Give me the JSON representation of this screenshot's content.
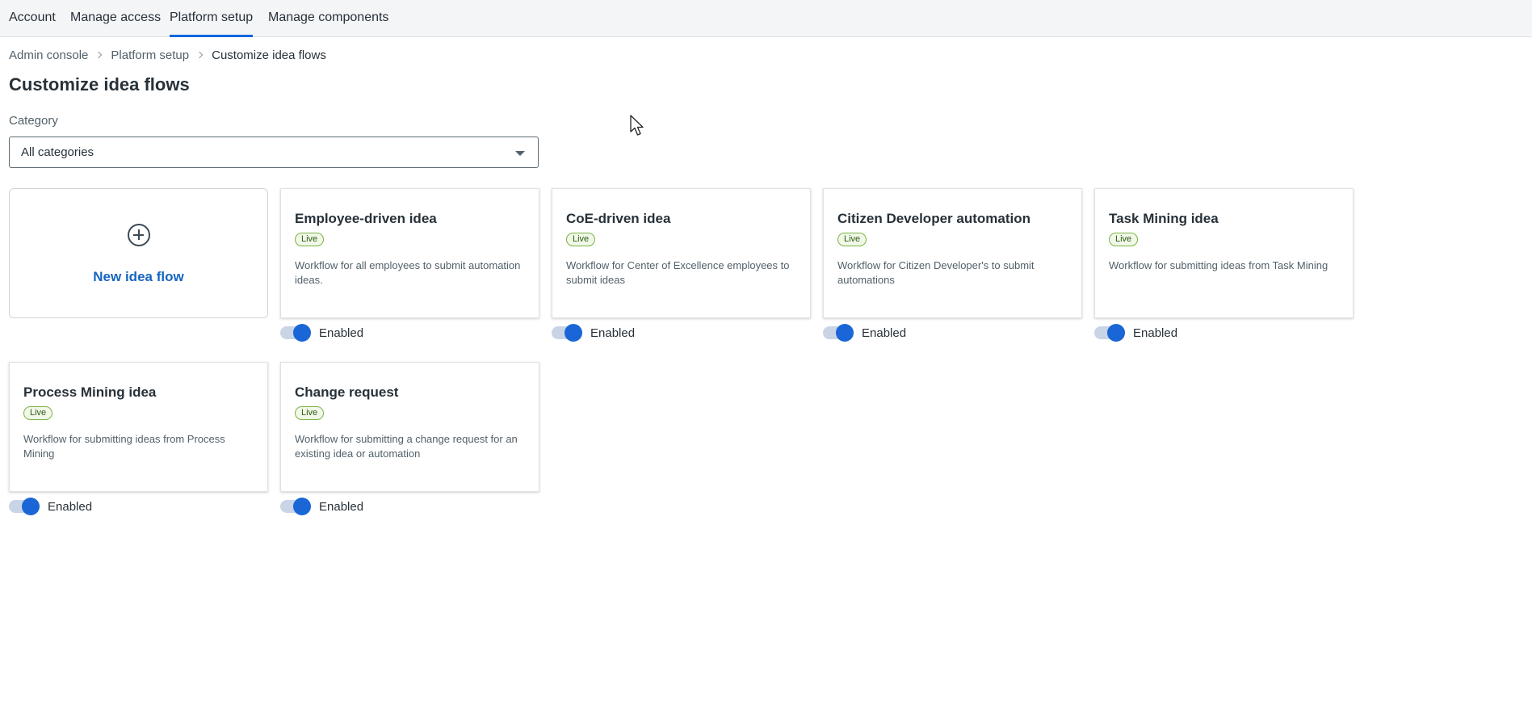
{
  "nav": {
    "tabs": [
      {
        "label": "Account",
        "active": false
      },
      {
        "label": "Manage access",
        "active": false
      },
      {
        "label": "Platform setup",
        "active": true
      },
      {
        "label": "Manage components",
        "active": false
      }
    ]
  },
  "breadcrumb": [
    "Admin console",
    "Platform setup",
    "Customize idea flows"
  ],
  "page": {
    "title": "Customize idea flows"
  },
  "filter": {
    "label": "Category",
    "value": "All categories"
  },
  "new_flow": {
    "label": "New idea flow"
  },
  "flows": [
    {
      "title": "Employee-driven idea",
      "status": "Live",
      "description": "Workflow for all employees to submit automation ideas.",
      "toggle_label": "Enabled",
      "enabled": true
    },
    {
      "title": "CoE-driven idea",
      "status": "Live",
      "description": "Workflow for Center of Excellence employees to submit ideas",
      "toggle_label": "Enabled",
      "enabled": true
    },
    {
      "title": "Citizen Developer automation",
      "status": "Live",
      "description": "Workflow for Citizen Developer's to submit automations",
      "toggle_label": "Enabled",
      "enabled": true
    },
    {
      "title": "Task Mining idea",
      "status": "Live",
      "description": "Workflow for submitting ideas from Task Mining",
      "toggle_label": "Enabled",
      "enabled": true
    },
    {
      "title": "Process Mining idea",
      "status": "Live",
      "description": "Workflow for submitting ideas from Process Mining",
      "toggle_label": "Enabled",
      "enabled": true
    },
    {
      "title": "Change request",
      "status": "Live",
      "description": "Workflow for submitting a change request for an existing idea or automation",
      "toggle_label": "Enabled",
      "enabled": true
    }
  ],
  "colors": {
    "accent": "#1a66d6",
    "link": "#1665c0",
    "live_badge_border": "#7cb342"
  }
}
